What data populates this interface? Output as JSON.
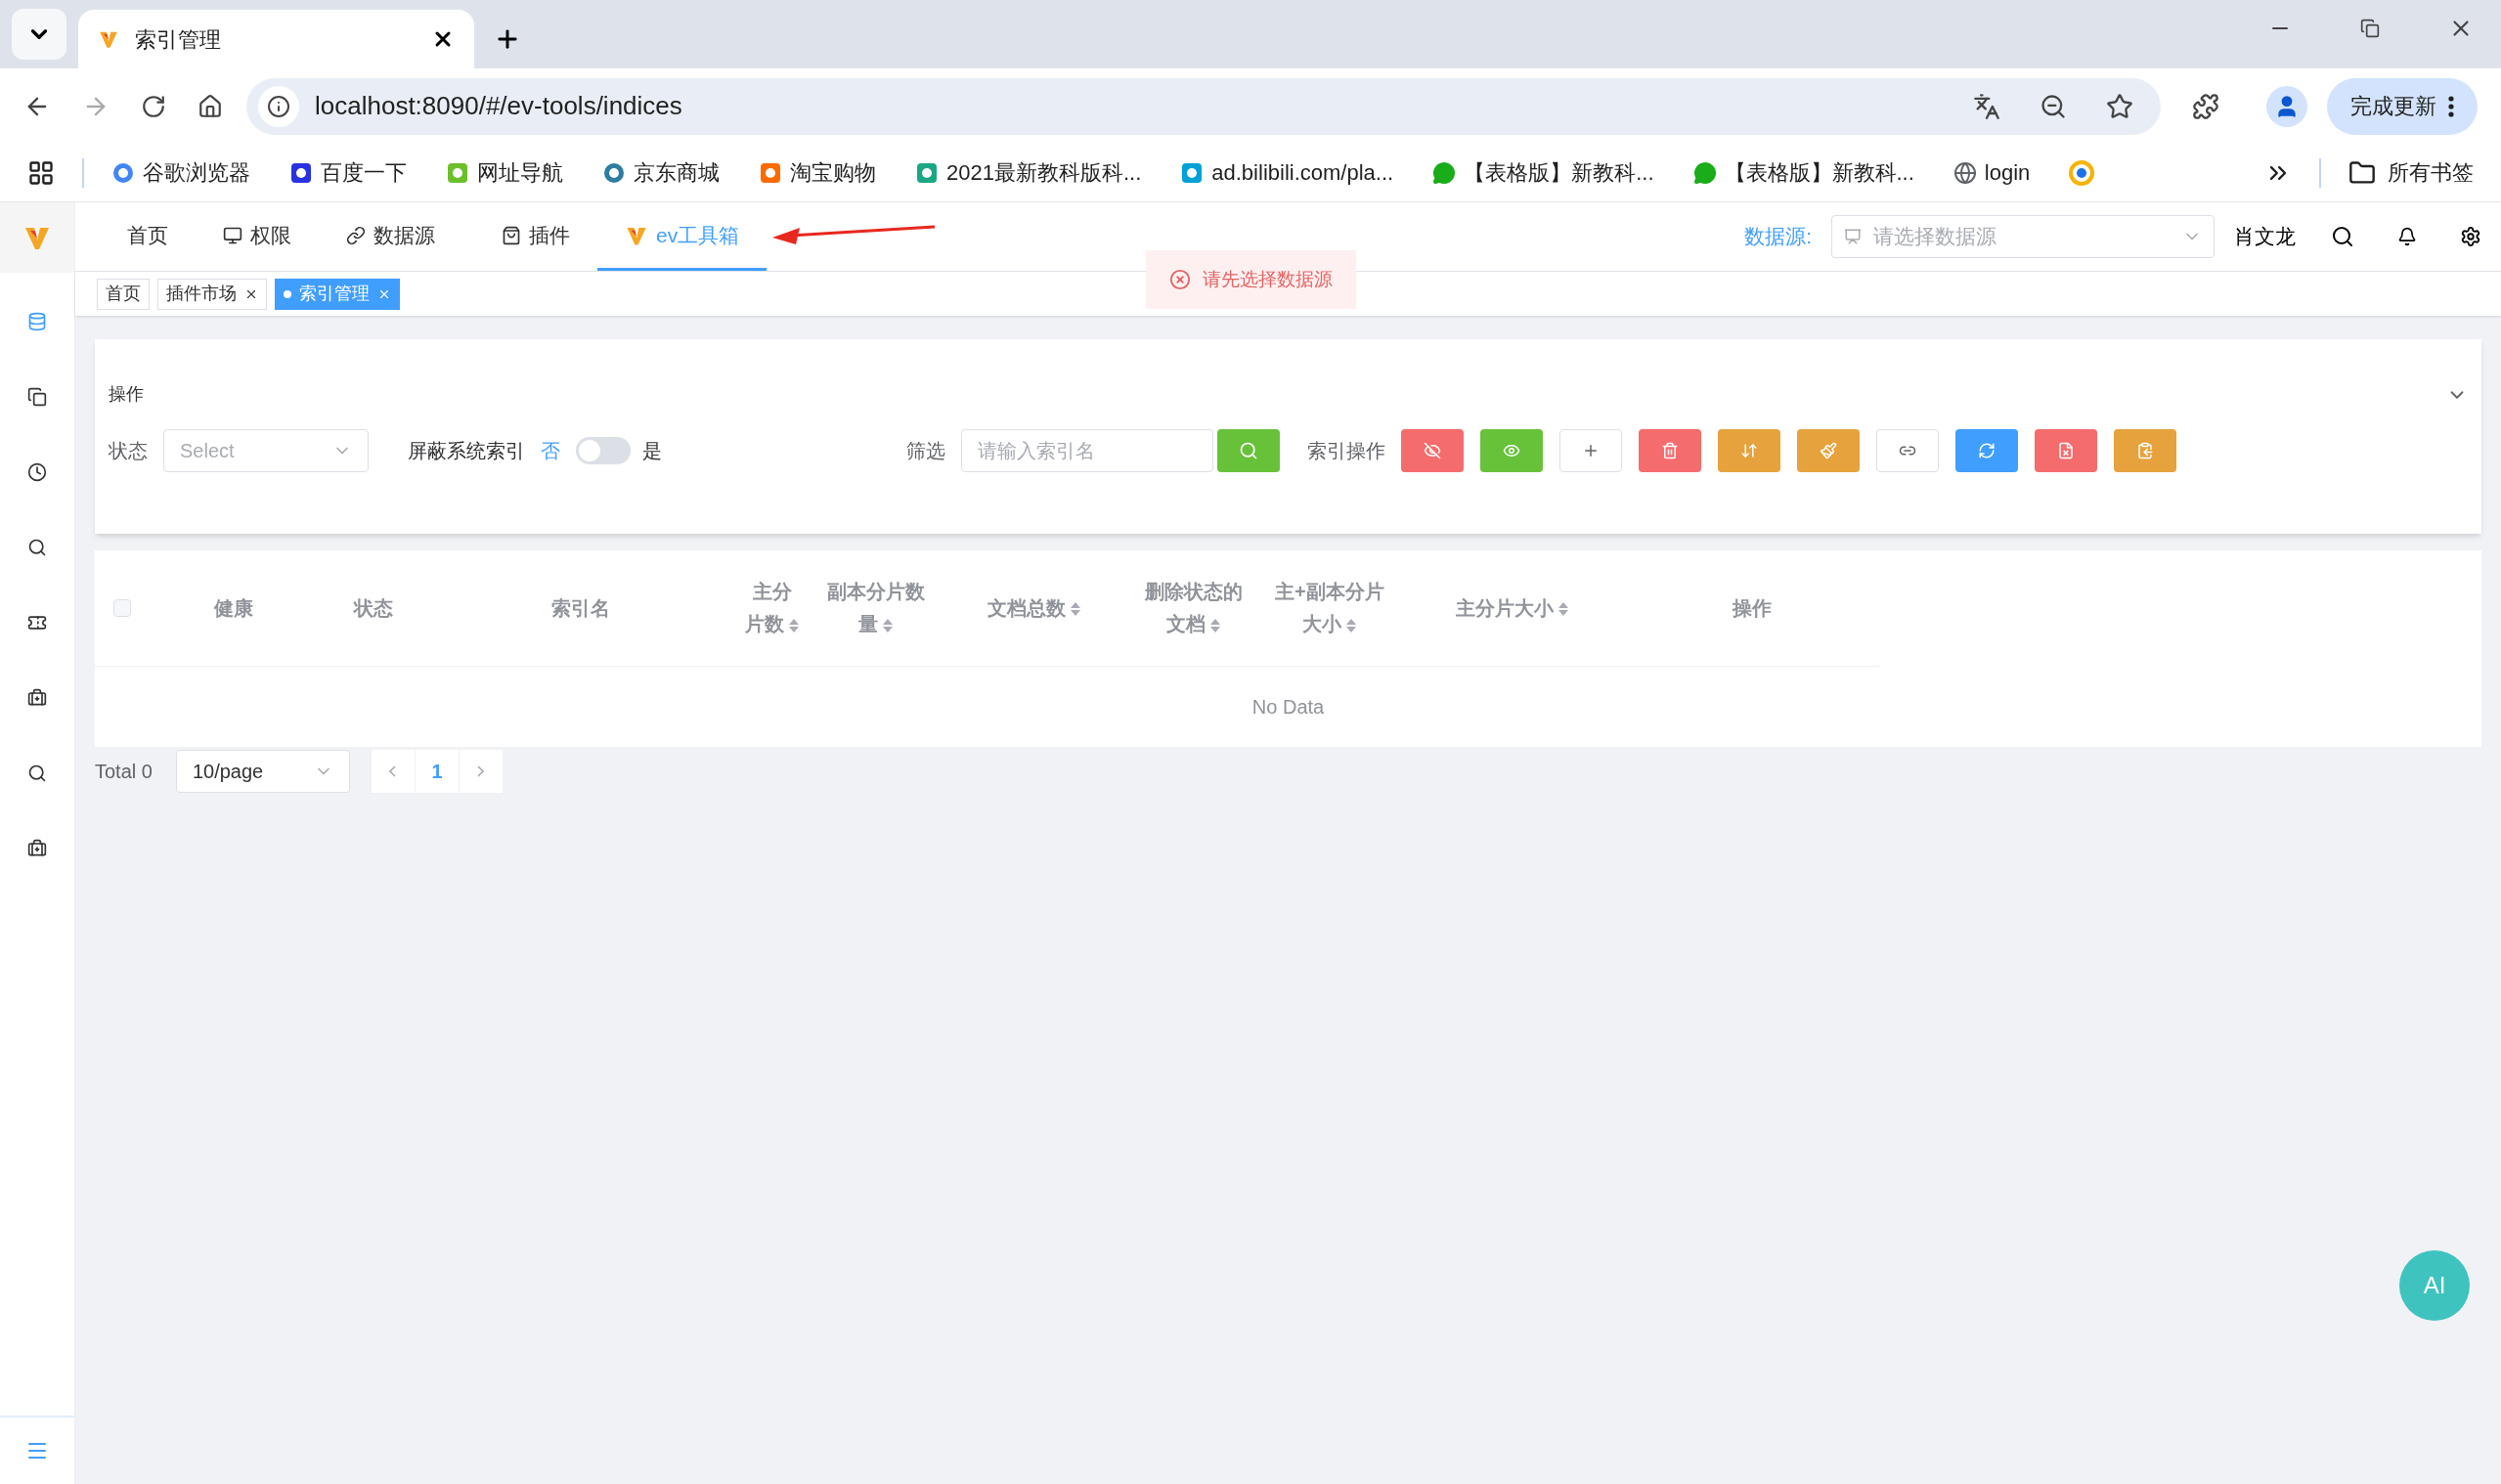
{
  "browser": {
    "tab_title": "索引管理",
    "url": "localhost:8090/#/ev-tools/indices",
    "update_button": "完成更新",
    "bookmarks": [
      {
        "label": "谷歌浏览器"
      },
      {
        "label": "百度一下"
      },
      {
        "label": "网址导航"
      },
      {
        "label": "京东商城"
      },
      {
        "label": "淘宝购物"
      },
      {
        "label": "2021最新教科版科..."
      },
      {
        "label": "ad.bilibili.com/pla..."
      },
      {
        "label": "【表格版】新教科..."
      },
      {
        "label": "【表格版】新教科..."
      },
      {
        "label": "login"
      }
    ],
    "all_bookmarks": "所有书签"
  },
  "header": {
    "nav": [
      {
        "label": "首页",
        "selected": false
      },
      {
        "label": "权限",
        "selected": false
      },
      {
        "label": "数据源",
        "selected": false
      },
      {
        "label": "插件",
        "selected": false
      },
      {
        "label": "ev工具箱",
        "selected": true
      }
    ],
    "datasource_label": "数据源:",
    "datasource_select": {
      "placeholder": "请选择数据源"
    },
    "user": "肖文龙"
  },
  "tags": [
    {
      "label": "首页",
      "selected": false,
      "closable": false
    },
    {
      "label": "插件市场",
      "selected": false,
      "closable": true
    },
    {
      "label": "索引管理",
      "selected": true,
      "closable": true
    }
  ],
  "toast": "请先选择数据源",
  "sidebar": {
    "items": [
      {
        "selected": true
      },
      {
        "selected": false
      },
      {
        "selected": false
      },
      {
        "selected": false
      },
      {
        "selected": false
      },
      {
        "selected": false
      },
      {
        "selected": false
      },
      {
        "selected": false
      }
    ]
  },
  "panel": {
    "title": "操作",
    "status_label": "状态",
    "status_select": {
      "placeholder": "Select"
    },
    "hide_label": "屏蔽系统索引",
    "switch_off_label": "否",
    "switch_on_label": "是",
    "switch_on": false,
    "filter_label": "筛选",
    "search": {
      "placeholder": "请输入索引名"
    },
    "ops_label": "索引操作",
    "ops": [
      {
        "color": "#f56c6c"
      },
      {
        "color": "#67c23a"
      },
      {
        "color": "#ffffff"
      },
      {
        "color": "#f56c6c"
      },
      {
        "color": "#e6a23c"
      },
      {
        "color": "#e6a23c"
      },
      {
        "color": "#ffffff"
      },
      {
        "color": "#409eff"
      },
      {
        "color": "#f56c6c"
      },
      {
        "color": "#e6a23c"
      }
    ]
  },
  "table": {
    "columns": [
      {
        "label": "健康",
        "sortable": false
      },
      {
        "label": "状态",
        "sortable": false
      },
      {
        "label": "索引名",
        "sortable": false
      },
      {
        "label": "主分片数",
        "sortable": true
      },
      {
        "label": "副本分片数量",
        "sortable": true
      },
      {
        "label": "文档总数",
        "sortable": true
      },
      {
        "label": "删除状态的文档",
        "sortable": true
      },
      {
        "label": "主+副本分片大小",
        "sortable": true
      },
      {
        "label": "主分片大小",
        "sortable": true
      },
      {
        "label": "操作",
        "sortable": false
      }
    ],
    "select_all_checked": false,
    "empty_text": "No Data"
  },
  "pagination": {
    "total": "Total 0",
    "page_size": "10/page",
    "pages": [
      {
        "label": "1",
        "selected": true
      }
    ]
  },
  "ai_button": "AI"
}
